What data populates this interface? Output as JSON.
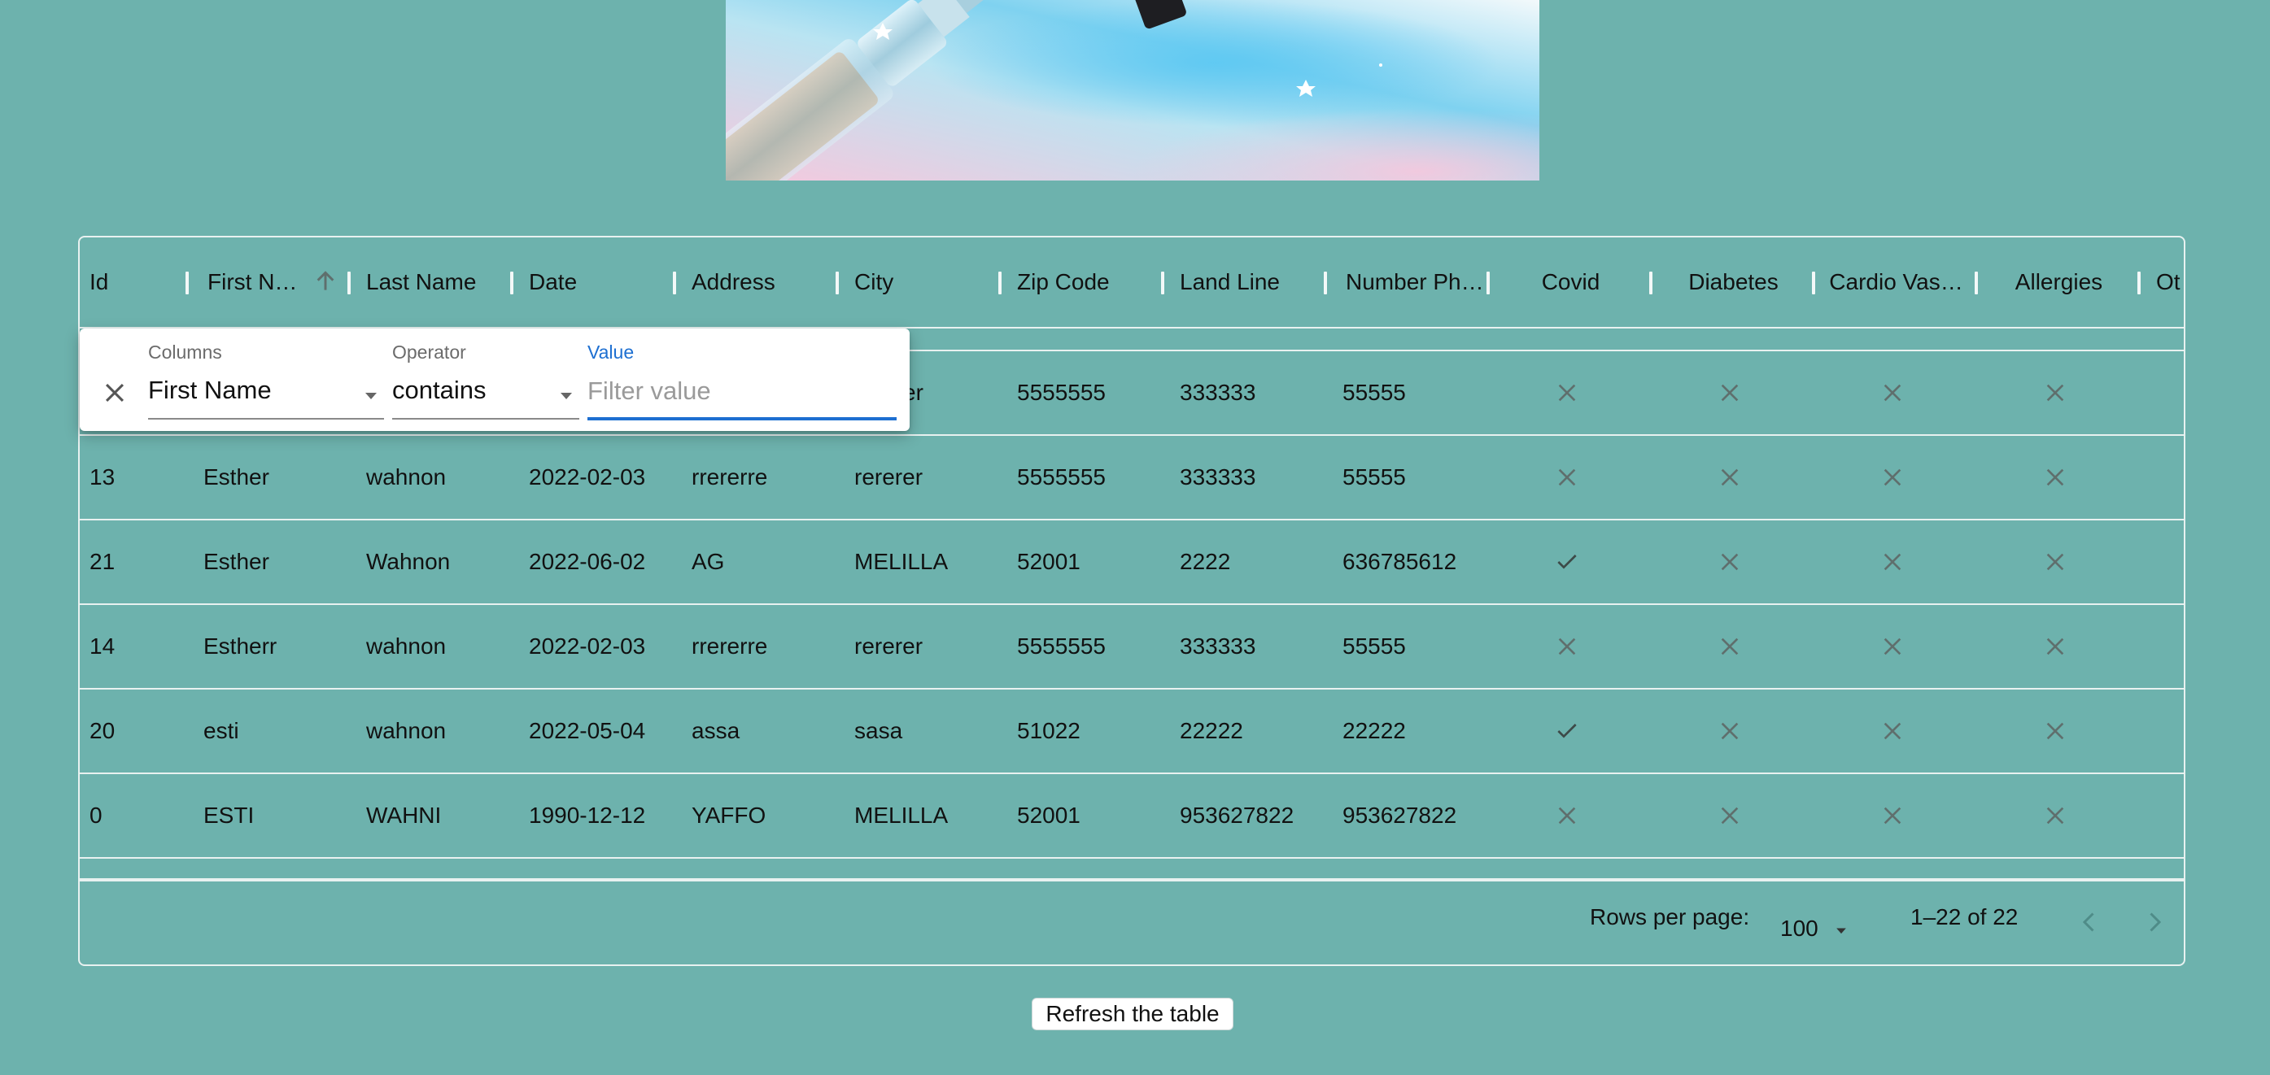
{
  "grid": {
    "columns": [
      {
        "label": "Id"
      },
      {
        "label": "First N…"
      },
      {
        "label": "Last Name"
      },
      {
        "label": "Date"
      },
      {
        "label": "Address"
      },
      {
        "label": "City"
      },
      {
        "label": "Zip Code"
      },
      {
        "label": "Land Line"
      },
      {
        "label": "Number Ph…"
      },
      {
        "label": "Covid"
      },
      {
        "label": "Diabetes"
      },
      {
        "label": "Cardio Vas…"
      },
      {
        "label": "Allergies"
      },
      {
        "label": "Ot"
      }
    ],
    "sort": {
      "column": "First N…",
      "direction": "ascending"
    },
    "partial_row": {
      "city": "er",
      "zip": "5555555",
      "land_line": "333333",
      "number_phone": "55555",
      "covid": false,
      "diabetes": false,
      "cardio": false,
      "allergies": false
    },
    "rows": [
      {
        "id": "13",
        "first_name": "Esther",
        "last_name": "wahnon",
        "date": "2022-02-03",
        "address": "rrererre",
        "city": "rererer",
        "zip": "5555555",
        "land_line": "333333",
        "number_phone": "55555",
        "covid": false,
        "diabetes": false,
        "cardio": false,
        "allergies": false
      },
      {
        "id": "21",
        "first_name": "Esther",
        "last_name": "Wahnon",
        "date": "2022-06-02",
        "address": "AG",
        "city": "MELILLA",
        "zip": "52001",
        "land_line": "2222",
        "number_phone": "636785612",
        "covid": true,
        "diabetes": false,
        "cardio": false,
        "allergies": false
      },
      {
        "id": "14",
        "first_name": "Estherr",
        "last_name": "wahnon",
        "date": "2022-02-03",
        "address": "rrererre",
        "city": "rererer",
        "zip": "5555555",
        "land_line": "333333",
        "number_phone": "55555",
        "covid": false,
        "diabetes": false,
        "cardio": false,
        "allergies": false
      },
      {
        "id": "20",
        "first_name": "esti",
        "last_name": "wahnon",
        "date": "2022-05-04",
        "address": "assa",
        "city": "sasa",
        "zip": "51022",
        "land_line": "22222",
        "number_phone": "22222",
        "covid": true,
        "diabetes": false,
        "cardio": false,
        "allergies": false
      },
      {
        "id": "0",
        "first_name": "ESTI",
        "last_name": "WAHNI",
        "date": "1990-12-12",
        "address": "YAFFO",
        "city": "MELILLA",
        "zip": "52001",
        "land_line": "953627822",
        "number_phone": "953627822",
        "covid": false,
        "diabetes": false,
        "cardio": false,
        "allergies": false
      }
    ]
  },
  "footer": {
    "rows_per_page_label": "Rows per page:",
    "rows_per_page_value": "100",
    "range": "1–22 of 22"
  },
  "filter_panel": {
    "columns_label": "Columns",
    "columns_value": "First Name",
    "operator_label": "Operator",
    "operator_value": "contains",
    "value_label": "Value",
    "value_placeholder": "Filter value",
    "value": ""
  },
  "refresh_button_label": "Refresh the table",
  "colors": {
    "background": "#6db2ad",
    "accent": "#1d6fd1",
    "icon": "#5f6f6d"
  }
}
